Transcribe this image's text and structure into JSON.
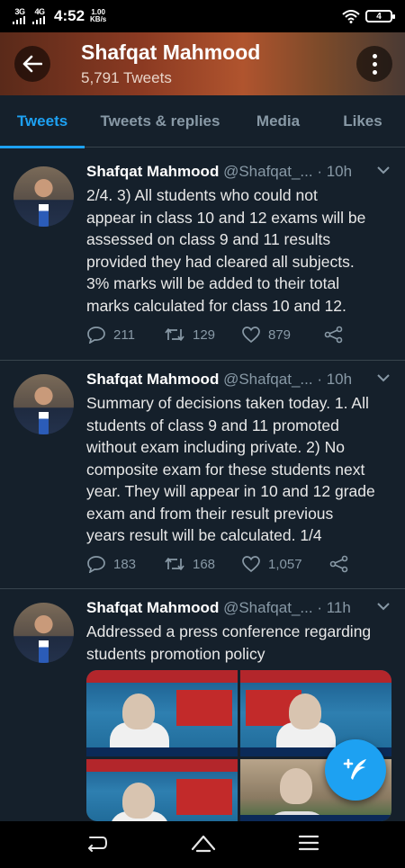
{
  "status_bar": {
    "signal1": "3G",
    "signal2": "4G",
    "time": "4:52",
    "speed_value": "1.00",
    "speed_unit": "KB/s",
    "battery": "4"
  },
  "header": {
    "title": "Shafqat Mahmood",
    "subtitle": "5,791 Tweets"
  },
  "tabs": [
    {
      "label": "Tweets",
      "active": true
    },
    {
      "label": "Tweets & replies",
      "active": false
    },
    {
      "label": "Media",
      "active": false
    },
    {
      "label": "Likes",
      "active": false
    }
  ],
  "tweets": [
    {
      "name": "Shafqat Mahmood",
      "handle": "@Shafqat_...",
      "time": "· 10h",
      "lines": [
        "2/4. 3) All students who could not",
        "appear in class 10 and 12 exams will be",
        "assessed on class 9 and 11 results",
        "provided they had cleared all subjects.",
        "3% marks will be added to their total",
        "marks calculated for class 10 and 12."
      ],
      "replies": "211",
      "retweets": "129",
      "likes": "879"
    },
    {
      "name": "Shafqat Mahmood",
      "handle": "@Shafqat_...",
      "time": "· 10h",
      "lines": [
        "Summary of decisions taken today. 1. All",
        "students of class 9 and 11 promoted",
        "without exam including private. 2) No",
        "composite exam for these students next",
        "year. They will appear in 10 and 12 grade",
        "exam and from their result previous",
        "years result will be calculated. 1/4"
      ],
      "replies": "183",
      "retweets": "168",
      "likes": "1,057"
    },
    {
      "name": "Shafqat Mahmood",
      "handle": "@Shafqat_...",
      "time": "· 11h",
      "lines": [
        "Addressed a press conference regarding",
        "students promotion policy"
      ]
    }
  ],
  "icons": {
    "back": "arrow-left-icon",
    "more": "more-vertical-icon",
    "reply": "comment-icon",
    "retweet": "retweet-icon",
    "like": "heart-icon",
    "share": "share-icon",
    "compose": "compose-tweet-icon"
  },
  "colors": {
    "accent": "#1da1f2",
    "background": "#15202b",
    "muted": "#8899a6"
  }
}
